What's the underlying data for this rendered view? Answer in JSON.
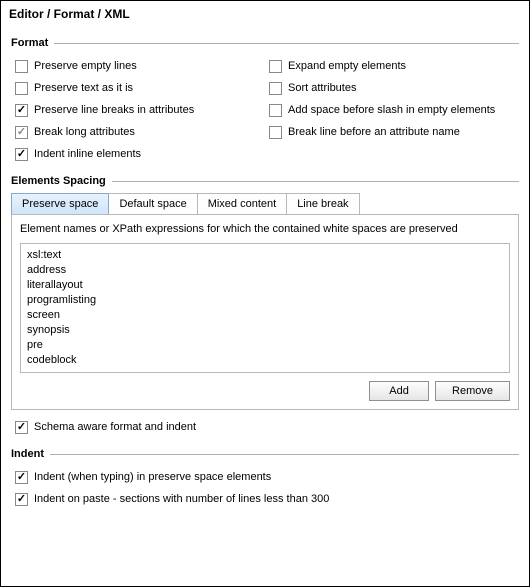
{
  "title": "Editor / Format / XML",
  "groups": {
    "format": {
      "label": "Format"
    },
    "elements_spacing": {
      "label": "Elements Spacing"
    },
    "indent": {
      "label": "Indent"
    }
  },
  "format_options": {
    "left": [
      {
        "label": "Preserve empty lines",
        "checked": false
      },
      {
        "label": "Preserve text as it is",
        "checked": false
      },
      {
        "label": "Preserve line breaks in attributes",
        "checked": true
      },
      {
        "label": "Break long attributes",
        "checked": true,
        "grey": true
      },
      {
        "label": "Indent inline elements",
        "checked": true
      }
    ],
    "right": [
      {
        "label": "Expand empty elements",
        "checked": false
      },
      {
        "label": "Sort attributes",
        "checked": false
      },
      {
        "label": "Add space before slash in empty elements",
        "checked": false
      },
      {
        "label": "Break line before an attribute name",
        "checked": false
      }
    ]
  },
  "tabs": {
    "items": [
      {
        "label": "Preserve space",
        "active": true
      },
      {
        "label": "Default space",
        "active": false
      },
      {
        "label": "Mixed content",
        "active": false
      },
      {
        "label": "Line break",
        "active": false
      }
    ],
    "description": "Element names or XPath expressions for which the contained white spaces are preserved",
    "list": [
      "xsl:text",
      "address",
      "literallayout",
      "programlisting",
      "screen",
      "synopsis",
      "pre",
      "codeblock"
    ],
    "buttons": {
      "add": "Add",
      "remove": "Remove"
    }
  },
  "schema_aware": {
    "label": "Schema aware format and indent",
    "checked": true
  },
  "indent_options": [
    {
      "label": "Indent (when typing) in preserve space elements",
      "checked": true
    },
    {
      "label": "Indent on paste - sections with number of lines less than 300",
      "checked": true
    }
  ]
}
